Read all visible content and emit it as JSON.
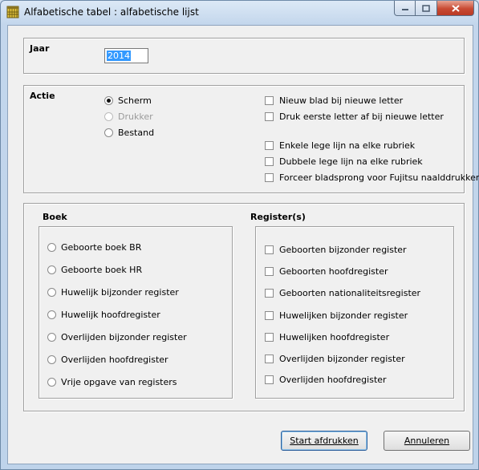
{
  "window": {
    "title": "Alfabetische tabel : alfabetische lijst"
  },
  "jaar": {
    "label": "Jaar",
    "value": "2014"
  },
  "actie": {
    "label": "Actie",
    "options": [
      {
        "label": "Scherm",
        "selected": true,
        "disabled": false
      },
      {
        "label": "Drukker",
        "selected": false,
        "disabled": true
      },
      {
        "label": "Bestand",
        "selected": false,
        "disabled": false
      }
    ],
    "checks": [
      "Nieuw blad bij nieuwe letter",
      "Druk eerste letter af bij nieuwe letter",
      "Enkele lege lijn na elke rubriek",
      "Dubbele lege lijn na elke rubriek",
      "Forceer bladsprong voor Fujitsu naalddrukker"
    ]
  },
  "boek": {
    "label": "Boek",
    "options": [
      "Geboorte boek BR",
      "Geboorte boek HR",
      "Huwelijk bijzonder register",
      "Huwelijk hoofdregister",
      "Overlijden bijzonder register",
      "Overlijden hoofdregister",
      "Vrije opgave van registers"
    ]
  },
  "registers": {
    "label": "Register(s)",
    "options": [
      "Geboorten bijzonder register",
      "Geboorten hoofdregister",
      "Geboorten nationaliteitsregister",
      "Huwelijken bijzonder register",
      "Huwelijken hoofdregister",
      "Overlijden bijzonder register",
      "Overlijden hoofdregister"
    ]
  },
  "buttons": {
    "start": "Start afdrukken",
    "cancel": "Annuleren"
  }
}
